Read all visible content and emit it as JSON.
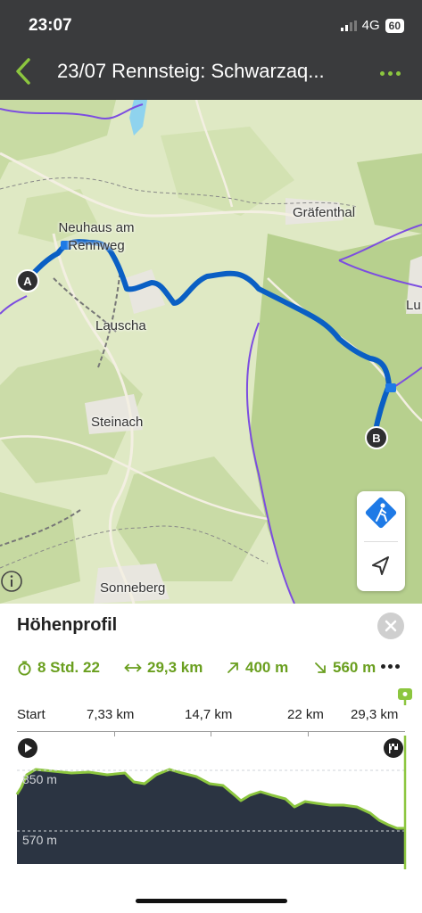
{
  "status": {
    "time": "23:07",
    "network": "4G",
    "battery": "60"
  },
  "nav": {
    "title": "23/07 Rennsteig: Schwarzaq..."
  },
  "map": {
    "towns": [
      "Neuhaus am Rennweg",
      "Gräfenthal",
      "Lauscha",
      "Steinach",
      "Sonneberg",
      "Lu"
    ],
    "start_marker": "A",
    "end_marker": "B",
    "route_color": "#0a5fc4",
    "sport_color": "#1e7ae6"
  },
  "sheet": {
    "title": "Höhenprofil",
    "duration": "8 Std. 22",
    "distance": "29,3 km",
    "ascent": "400 m",
    "descent": "560 m",
    "axis": [
      "Start",
      "7,33 km",
      "14,7 km",
      "22 km",
      "29,3 km"
    ],
    "elevation_labels": [
      "850 m",
      "570 m"
    ],
    "accent": "#6a9f1f"
  }
}
